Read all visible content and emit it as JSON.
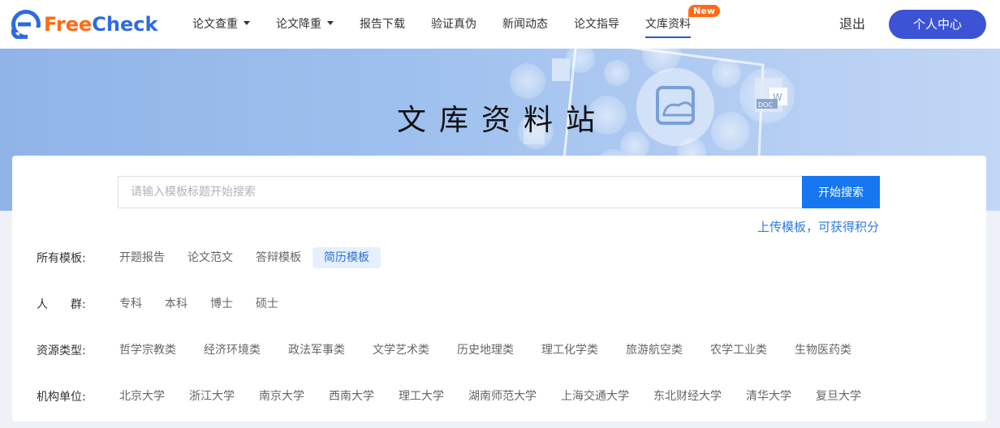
{
  "header": {
    "logo": {
      "free": "Free",
      "check": "Check"
    },
    "nav": [
      {
        "label": "论文查重",
        "dropdown": true
      },
      {
        "label": "论文降重",
        "dropdown": true
      },
      {
        "label": "报告下载"
      },
      {
        "label": "验证真伪"
      },
      {
        "label": "新闻动态"
      },
      {
        "label": "论文指导"
      },
      {
        "label": "文库资料",
        "active": true,
        "badge": "New"
      }
    ],
    "logout": "退出",
    "user_center": "个人中心"
  },
  "banner": {
    "title": "文库资料站"
  },
  "search": {
    "placeholder": "请输入模板标题开始搜索",
    "button": "开始搜索",
    "upload_link": "上传模板，可获得积分"
  },
  "filters": [
    {
      "label": "所有模板:",
      "options": [
        "开题报告",
        "论文范文",
        "答辩模板",
        "简历模板"
      ],
      "selected": "简历模板"
    },
    {
      "label": "人　　群:",
      "options": [
        "专科",
        "本科",
        "博士",
        "硕士"
      ]
    },
    {
      "label": "资源类型:",
      "options": [
        "哲学宗教类",
        "经济环境类",
        "政法军事类",
        "文学艺术类",
        "历史地理类",
        "理工化学类",
        "旅游航空类",
        "农学工业类",
        "生物医药类"
      ]
    },
    {
      "label": "机构单位:",
      "options": [
        "北京大学",
        "浙江大学",
        "南京大学",
        "西南大学",
        "理工大学",
        "湖南师范大学",
        "上海交通大学",
        "东北财经大学",
        "清华大学",
        "复旦大学"
      ]
    }
  ],
  "colors": {
    "brand_blue": "#3c53d6",
    "search_blue": "#1677f0",
    "badge_orange": "#ff6a1a",
    "logo_orange": "#ff6a13",
    "logo_blue": "#2d6bde"
  }
}
